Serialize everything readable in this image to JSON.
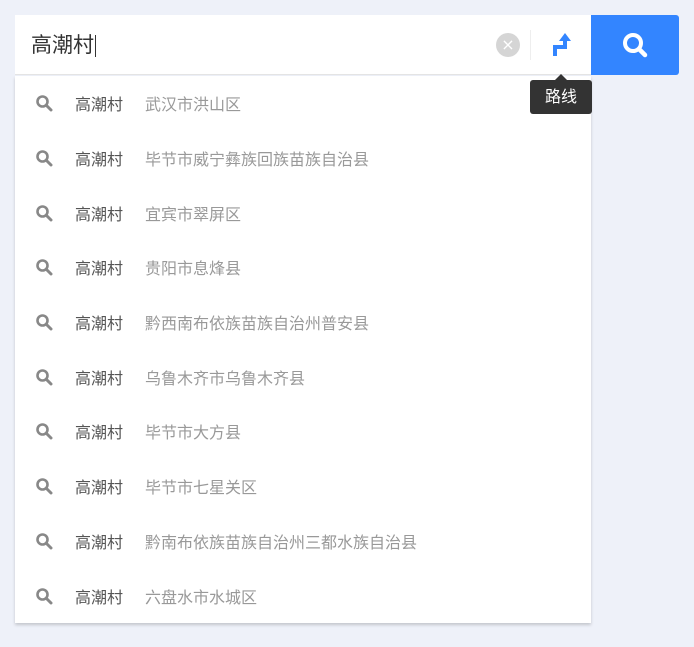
{
  "search": {
    "value": "高潮村",
    "clear_icon": "×",
    "route_tooltip": "路线"
  },
  "suggestions": [
    {
      "name": "高潮村",
      "address": "武汉市洪山区"
    },
    {
      "name": "高潮村",
      "address": "毕节市威宁彝族回族苗族自治县"
    },
    {
      "name": "高潮村",
      "address": "宜宾市翠屏区"
    },
    {
      "name": "高潮村",
      "address": "贵阳市息烽县"
    },
    {
      "name": "高潮村",
      "address": "黔西南布依族苗族自治州普安县"
    },
    {
      "name": "高潮村",
      "address": "乌鲁木齐市乌鲁木齐县"
    },
    {
      "name": "高潮村",
      "address": "毕节市大方县"
    },
    {
      "name": "高潮村",
      "address": "毕节市七星关区"
    },
    {
      "name": "高潮村",
      "address": "黔南布依族苗族自治州三都水族自治县"
    },
    {
      "name": "高潮村",
      "address": "六盘水市水城区"
    }
  ],
  "colors": {
    "accent": "#3385ff",
    "background": "#eef1f9"
  }
}
